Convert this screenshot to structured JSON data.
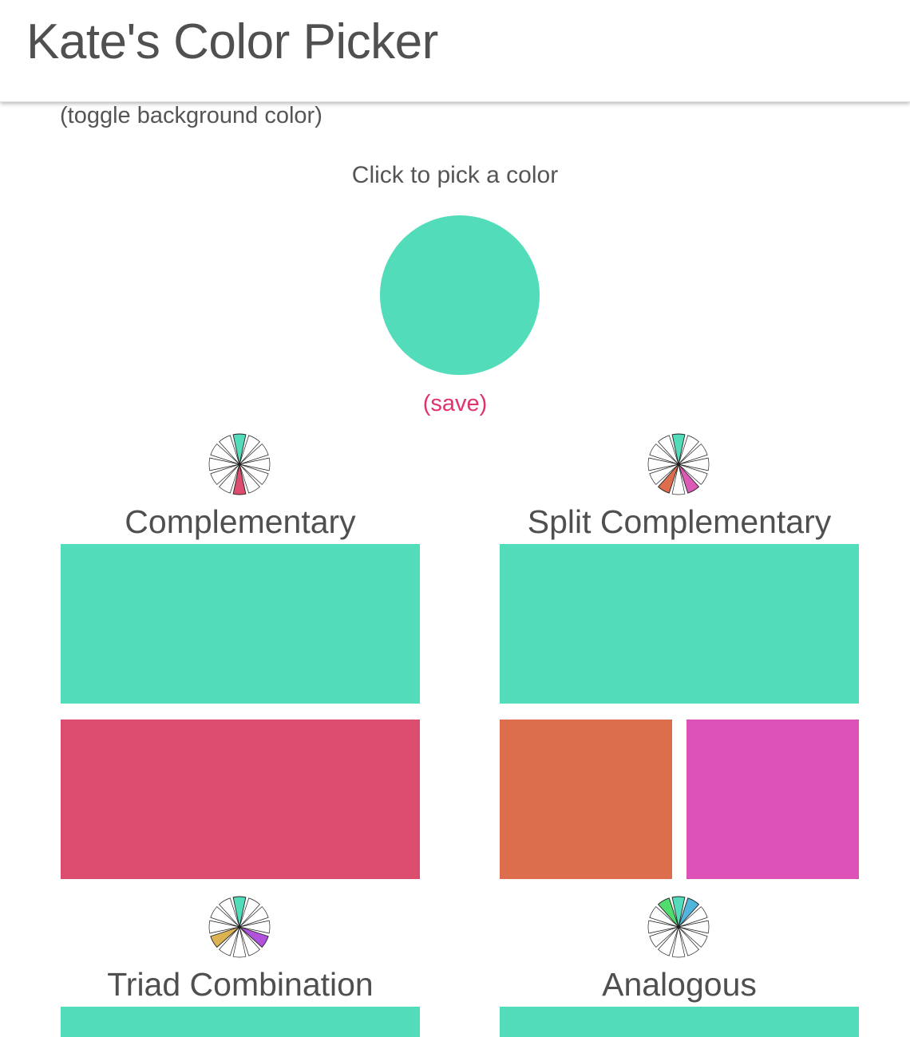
{
  "header": {
    "title": "Kate's Color Picker"
  },
  "toggle_background_label": "(toggle background color)",
  "picker": {
    "prompt": "Click to pick a color",
    "selected_color": "#52dcba",
    "save_label": "(save)",
    "save_color": "#e0336e"
  },
  "schemes": [
    {
      "title": "Complementary",
      "wheel_highlights": [
        {
          "slice": 0,
          "color": "#52dcba"
        },
        {
          "slice": 6,
          "color": "#dc4c6e"
        }
      ],
      "swatches": [
        "#52dcba",
        "#dc4c6e"
      ]
    },
    {
      "title": "Split Complementary",
      "wheel_highlights": [
        {
          "slice": 0,
          "color": "#52dcba"
        },
        {
          "slice": 5,
          "color": "#dc5ab6"
        },
        {
          "slice": 7,
          "color": "#dc6e4e"
        }
      ],
      "swatches": [
        "#52dcba",
        "#dc6e4e",
        "#dc52b6"
      ]
    },
    {
      "title": "Triad Combination",
      "wheel_highlights": [
        {
          "slice": 0,
          "color": "#52dcba"
        },
        {
          "slice": 4,
          "color": "#b252dc"
        },
        {
          "slice": 8,
          "color": "#dcb252"
        }
      ],
      "swatches": [
        "#52dcba"
      ]
    },
    {
      "title": "Analogous",
      "wheel_highlights": [
        {
          "slice": 11,
          "color": "#52dc6e"
        },
        {
          "slice": 0,
          "color": "#52dcba"
        },
        {
          "slice": 1,
          "color": "#52b6dc"
        }
      ],
      "swatches": [
        "#52dcba"
      ]
    }
  ]
}
